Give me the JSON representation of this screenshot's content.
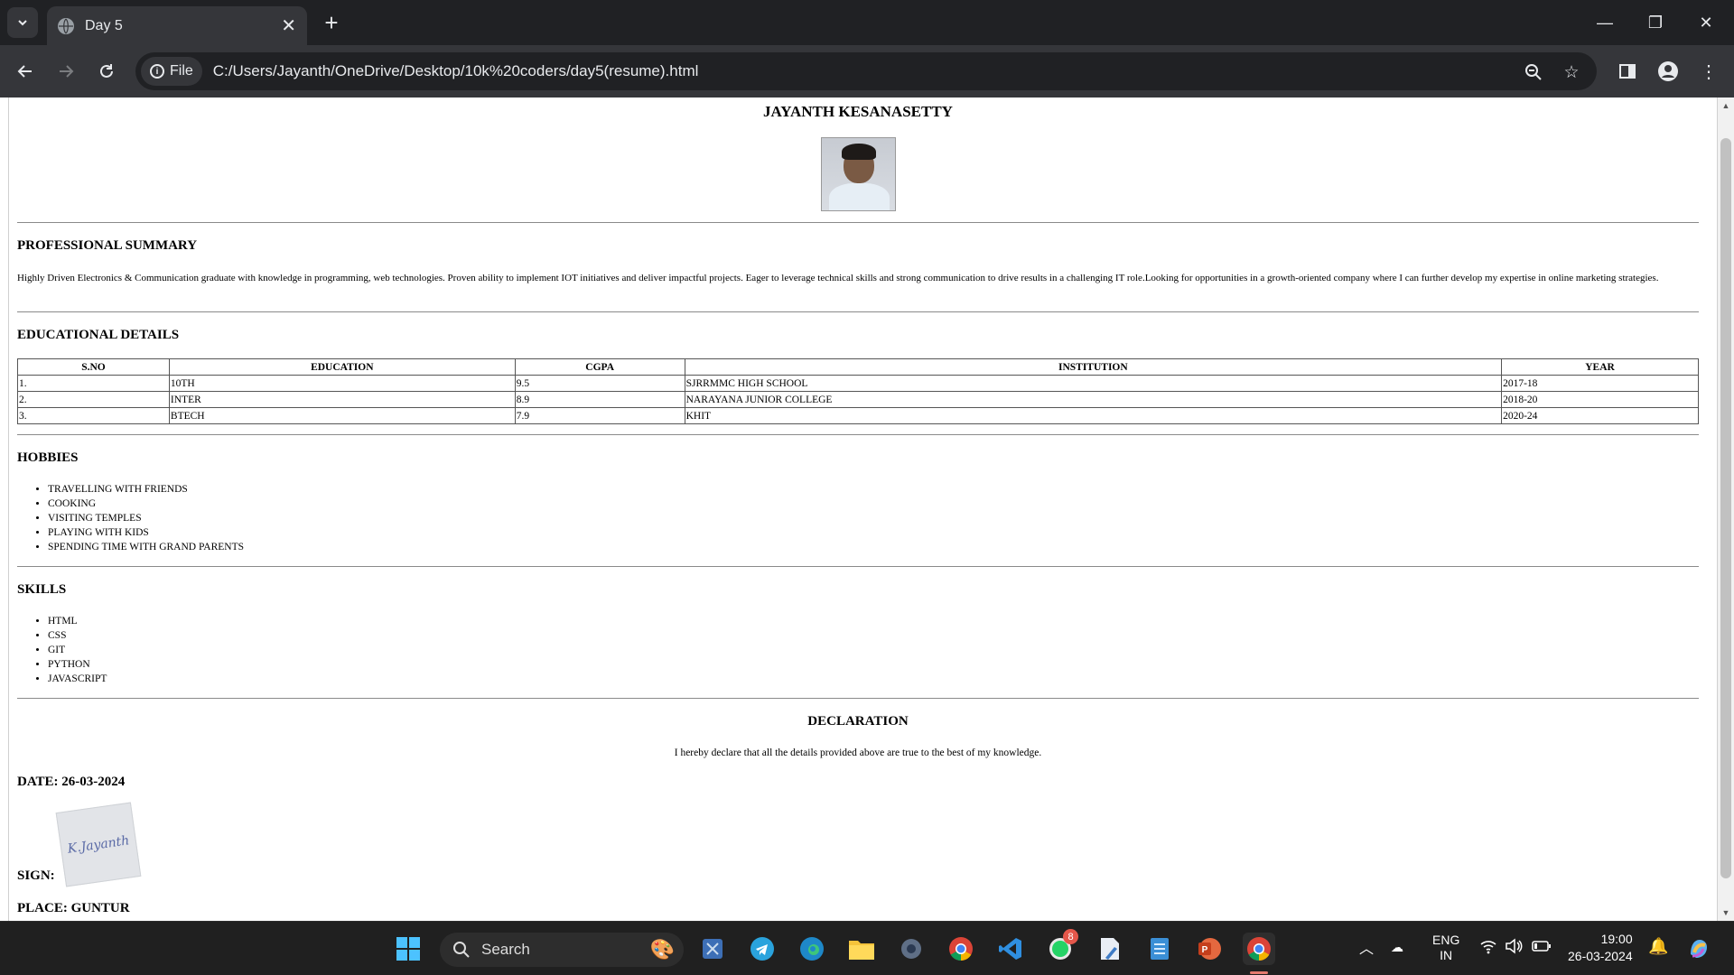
{
  "browser": {
    "tab_title": "Day 5",
    "site_chip": "File",
    "url": "C:/Users/Jayanth/OneDrive/Desktop/10k%20coders/day5(resume).html"
  },
  "resume": {
    "name": "JAYANTH KESANASETTY",
    "summary_heading": "PROFESSIONAL SUMMARY",
    "summary_text": "Highly Driven Electronics & Communication graduate with knowledge in programming, web technologies. Proven ability to implement IOT initiatives and deliver impactful projects. Eager to leverage technical skills and strong communication to drive results in a challenging IT role.Looking for opportunities in a growth-oriented company where I can further develop my expertise in online marketing strategies.",
    "education_heading": "EDUCATIONAL DETAILS",
    "education_columns": [
      "S.NO",
      "EDUCATION",
      "CGPA",
      "INSTITUTION",
      "YEAR"
    ],
    "education_rows": [
      [
        "1.",
        "10TH",
        "9.5",
        "SJRRMMC HIGH SCHOOL",
        "2017-18"
      ],
      [
        "2.",
        "INTER",
        "8.9",
        "NARAYANA JUNIOR COLLEGE",
        "2018-20"
      ],
      [
        "3.",
        "BTECH",
        "7.9",
        "KHIT",
        "2020-24"
      ]
    ],
    "hobbies_heading": "HOBBIES",
    "hobbies": [
      "TRAVELLING WITH FRIENDS",
      "COOKING",
      "VISITING TEMPLES",
      "PLAYING WITH KIDS",
      "SPENDING TIME WITH GRAND PARENTS"
    ],
    "skills_heading": "SKILLS",
    "skills": [
      "HTML",
      "CSS",
      "GIT",
      "PYTHON",
      "JAVASCRIPT"
    ],
    "declaration_heading": "DECLARATION",
    "declaration_text": "I hereby declare that all the details provided above are true to the best of my knowledge.",
    "date_label": "DATE: 26-03-2024",
    "sign_label": "SIGN:",
    "signature": "K.Jayanth",
    "place_label": "PLACE: GUNTUR"
  },
  "taskbar": {
    "search_placeholder": "Search",
    "whatsapp_badge": "8",
    "lang_top": "ENG",
    "lang_bottom": "IN",
    "time": "19:00",
    "date": "26-03-2024"
  }
}
